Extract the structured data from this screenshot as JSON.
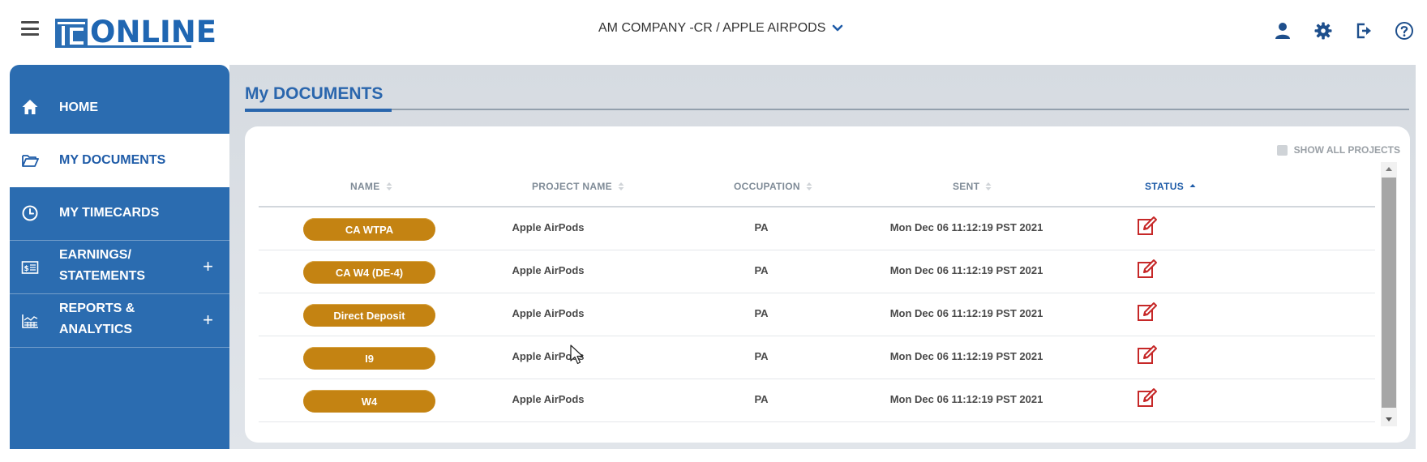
{
  "header": {
    "logo_text": "ONLINE",
    "logo_mark_text": "TC",
    "company_selector": "AM COMPANY -CR / APPLE AIRPODS",
    "icons": [
      "user-icon",
      "gear-icon",
      "logout-icon",
      "help-icon"
    ]
  },
  "sidebar": {
    "items": [
      {
        "label": "HOME",
        "icon": "home-icon",
        "active": false,
        "expandable": false
      },
      {
        "label": "MY DOCUMENTS",
        "icon": "folder-open-icon",
        "active": true,
        "expandable": false
      },
      {
        "label": "MY TIMECARDS",
        "icon": "clock-icon",
        "active": false,
        "expandable": false
      },
      {
        "label_line1": "EARNINGS/",
        "label_line2": "STATEMENTS",
        "icon": "money-statement-icon",
        "active": false,
        "expandable": true,
        "plus": "+"
      },
      {
        "label_line1": "REPORTS &",
        "label_line2": "ANALYTICS",
        "icon": "chart-analytics-icon",
        "active": false,
        "expandable": true,
        "plus": "+"
      }
    ]
  },
  "main": {
    "page_title": "My DOCUMENTS",
    "show_all_projects": {
      "label": "SHOW ALL PROJECTS",
      "checked": false
    },
    "table": {
      "columns": [
        "NAME",
        "PROJECT NAME",
        "OCCUPATION",
        "SENT",
        "STATUS"
      ],
      "sorted_column": "STATUS",
      "sort_direction": "ascending",
      "rows": [
        {
          "name": "CA WTPA",
          "project": "Apple AirPods",
          "occupation": "PA",
          "sent": "Mon Dec 06 11:12:19 PST 2021",
          "status": "edit-icon"
        },
        {
          "name": "CA W4 (DE-4)",
          "project": "Apple AirPods",
          "occupation": "PA",
          "sent": "Mon Dec 06 11:12:19 PST 2021",
          "status": "edit-icon"
        },
        {
          "name": "Direct Deposit",
          "project": "Apple AirPods",
          "occupation": "PA",
          "sent": "Mon Dec 06 11:12:19 PST 2021",
          "status": "edit-icon"
        },
        {
          "name": "I9",
          "project": "Apple AirPods",
          "occupation": "PA",
          "sent": "Mon Dec 06 11:12:19 PST 2021",
          "status": "edit-icon"
        },
        {
          "name": "W4",
          "project": "Apple AirPods",
          "occupation": "PA",
          "sent": "Mon Dec 06 11:12:19 PST 2021",
          "status": "edit-icon"
        }
      ]
    }
  },
  "colors": {
    "brand_blue": "#2b6cb0",
    "title_blue": "#2a66ad",
    "pill_gold": "#c48312",
    "status_red": "#c62828"
  }
}
